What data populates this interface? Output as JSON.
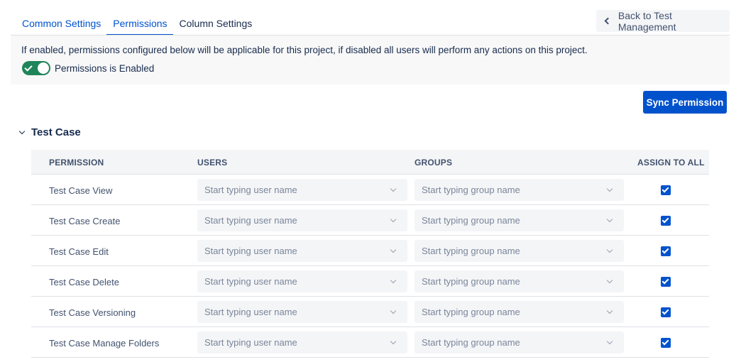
{
  "tabs": [
    {
      "label": "Common Settings",
      "active": false
    },
    {
      "label": "Permissions",
      "active": true
    },
    {
      "label": "Column Settings",
      "active": false
    }
  ],
  "back_button": {
    "label": "Back to Test Management",
    "icon": "chevron-left-icon"
  },
  "info": {
    "text": "If enabled, permissions configured below will be applicable for this project, if disabled all users will perform any actions on this project.",
    "toggle_label": "Permissions is Enabled",
    "toggle_on": true
  },
  "sync_button": {
    "label": "Sync Permission"
  },
  "section": {
    "title": "Test Case",
    "expanded": true
  },
  "table": {
    "headers": {
      "permission": "PERMISSION",
      "users": "USERS",
      "groups": "GROUPS",
      "assign_all": "ASSIGN TO ALL"
    },
    "rows": [
      {
        "name": "Test Case View",
        "users_placeholder": "Start typing user name",
        "groups_placeholder": "Start typing group name",
        "assign_all": true
      },
      {
        "name": "Test Case Create",
        "users_placeholder": "Start typing user name",
        "groups_placeholder": "Start typing group name",
        "assign_all": true
      },
      {
        "name": "Test Case Edit",
        "users_placeholder": "Start typing user name",
        "groups_placeholder": "Start typing group name",
        "assign_all": true
      },
      {
        "name": "Test Case Delete",
        "users_placeholder": "Start typing user name",
        "groups_placeholder": "Start typing group name",
        "assign_all": true
      },
      {
        "name": "Test Case Versioning",
        "users_placeholder": "Start typing user name",
        "groups_placeholder": "Start typing group name",
        "assign_all": true
      },
      {
        "name": "Test Case Manage Folders",
        "users_placeholder": "Start typing user name",
        "groups_placeholder": "Start typing group name",
        "assign_all": true
      }
    ]
  },
  "colors": {
    "primary": "#0052cc",
    "toggle_on": "#1f845a",
    "panel_bg": "#f8f8f8",
    "input_bg": "#f4f5f7"
  }
}
